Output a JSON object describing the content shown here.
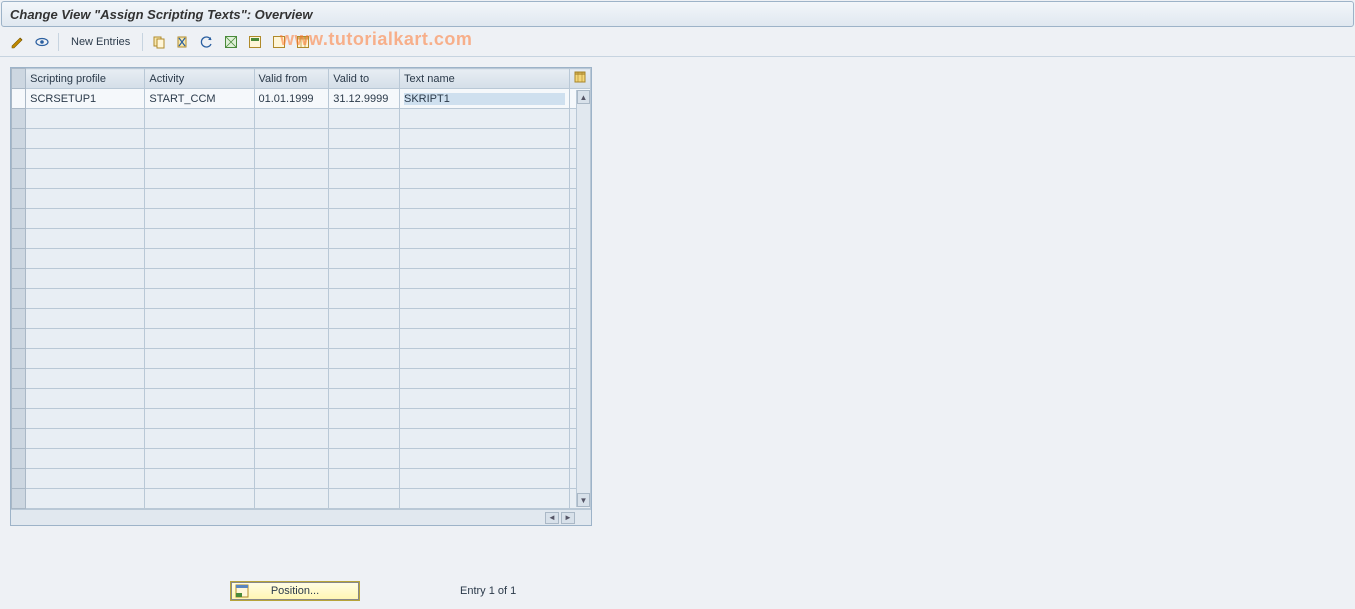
{
  "title": "Change View \"Assign Scripting Texts\": Overview",
  "toolbar": {
    "new_entries_label": "New Entries"
  },
  "watermark": "www.tutorialkart.com",
  "table": {
    "columns": [
      "Scripting profile",
      "Activity",
      "Valid from",
      "Valid to",
      "Text name"
    ],
    "rows": [
      {
        "scripting_profile": "SCRSETUP1",
        "activity": "START_CCM",
        "valid_from": "01.01.1999",
        "valid_to": "31.12.9999",
        "text_name": "SKRIPT1"
      }
    ],
    "blank_rows": 20
  },
  "footer": {
    "position_label": "Position...",
    "entry_counter": "Entry 1 of 1"
  },
  "colors": {
    "accent_yellow": "#fff6b0",
    "grid_border": "#b9c8d6",
    "header_bg": "#d4dee8"
  }
}
